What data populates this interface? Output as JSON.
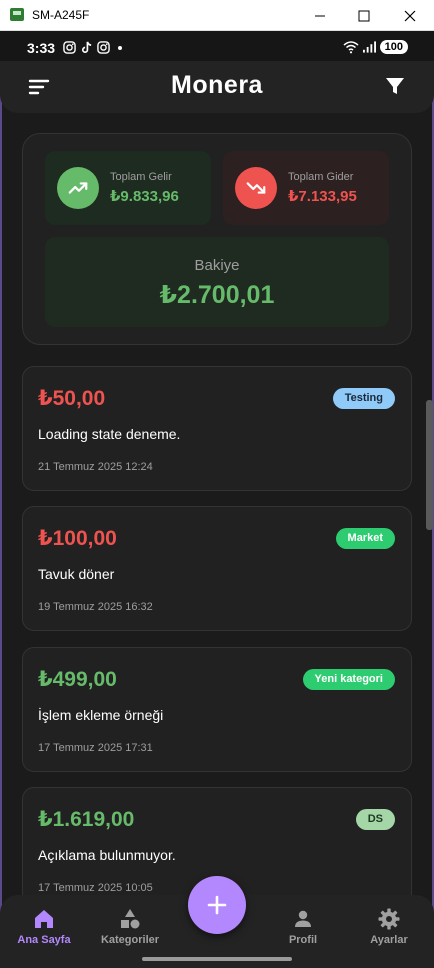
{
  "window": {
    "title": "SM-A245F"
  },
  "status_bar": {
    "time": "3:33",
    "battery": "100"
  },
  "app_bar": {
    "title": "Monera"
  },
  "summary": {
    "income_label": "Toplam Gelir",
    "income_value": "₺9.833,96",
    "expense_label": "Toplam Gider",
    "expense_value": "₺7.133,95",
    "balance_label": "Bakiye",
    "balance_value": "₺2.700,01"
  },
  "transactions": [
    {
      "amount": "₺50,00",
      "type": "expense",
      "category": "Testing",
      "category_color": "#90caf9",
      "description": "Loading state deneme.",
      "date": "21 Temmuz 2025 12:24"
    },
    {
      "amount": "₺100,00",
      "type": "expense",
      "category": "Market",
      "category_color": "#2ecc71",
      "description": "Tavuk döner",
      "date": "19 Temmuz 2025 16:32"
    },
    {
      "amount": "₺499,00",
      "type": "income",
      "category": "Yeni kategori",
      "category_color": "#2ecc71",
      "description": "İşlem ekleme örneği",
      "date": "17 Temmuz 2025 17:31"
    },
    {
      "amount": "₺1.619,00",
      "type": "income",
      "category": "DS",
      "category_color": "#a5d6a7",
      "description": "Açıklama bulunmuyor.",
      "date": "17 Temmuz 2025 10:05"
    }
  ],
  "bottom_nav": {
    "home": "Ana Sayfa",
    "categories": "Kategoriler",
    "profile": "Profil",
    "settings": "Ayarlar"
  },
  "colors": {
    "accent": "#b388ff",
    "income": "#66bb6a",
    "expense": "#ef5350"
  }
}
